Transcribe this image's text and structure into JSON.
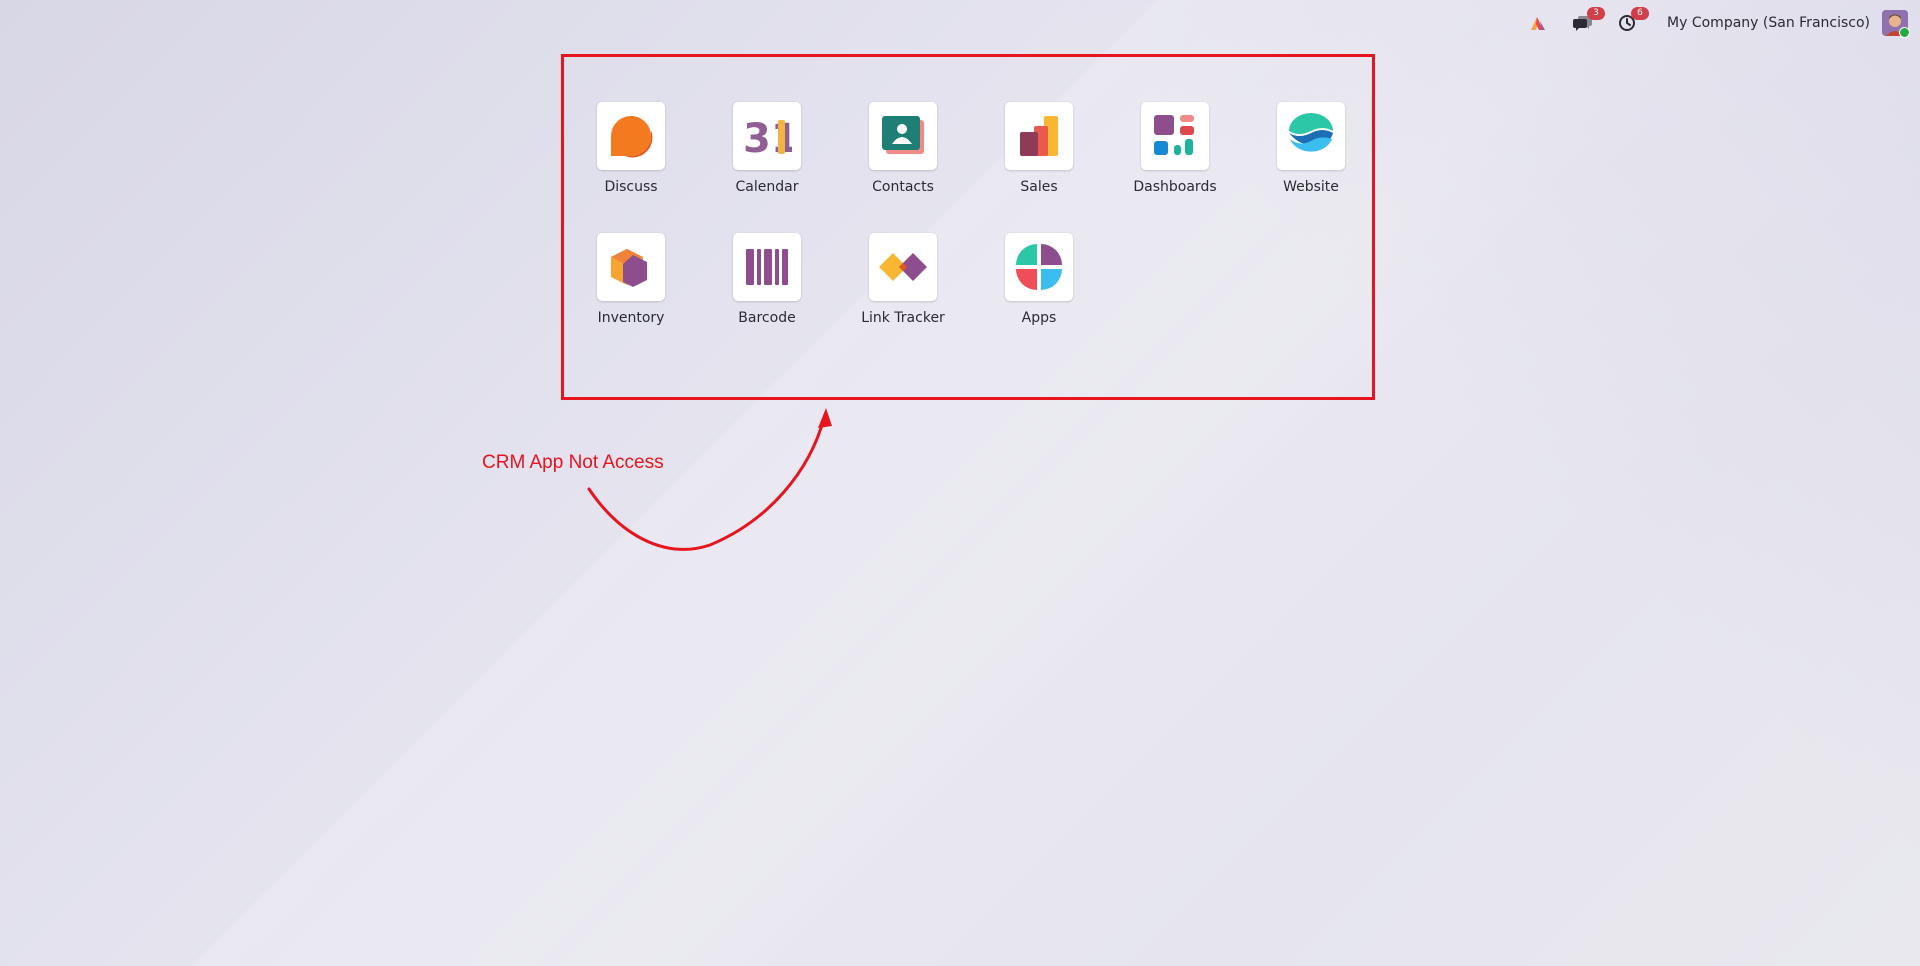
{
  "topbar": {
    "messages_badge": "3",
    "activities_badge": "6",
    "company_name": "My Company (San Francisco)"
  },
  "apps": [
    {
      "label": "Discuss",
      "icon": "discuss-icon"
    },
    {
      "label": "Calendar",
      "icon": "calendar-icon",
      "icon_text": "31"
    },
    {
      "label": "Contacts",
      "icon": "contacts-icon"
    },
    {
      "label": "Sales",
      "icon": "sales-icon"
    },
    {
      "label": "Dashboards",
      "icon": "dashboards-icon"
    },
    {
      "label": "Website",
      "icon": "website-icon"
    },
    {
      "label": "Inventory",
      "icon": "inventory-icon"
    },
    {
      "label": "Barcode",
      "icon": "barcode-icon"
    },
    {
      "label": "Link Tracker",
      "icon": "link-tracker-icon"
    },
    {
      "label": "Apps",
      "icon": "apps-icon"
    }
  ],
  "annotation": {
    "text": "CRM App Not Access",
    "color": "#e8141e"
  }
}
